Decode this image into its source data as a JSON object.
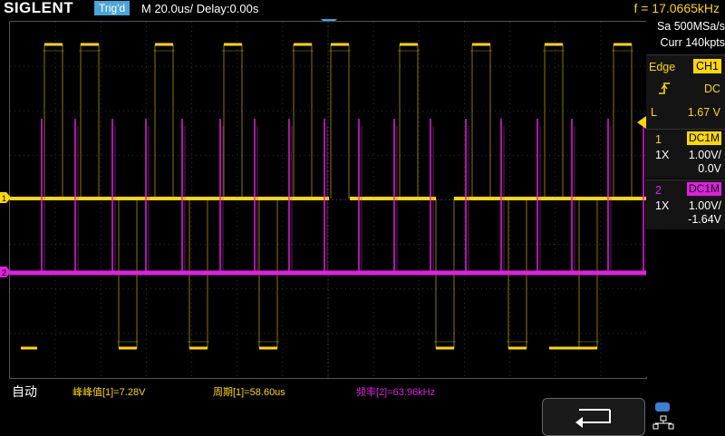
{
  "header": {
    "brand": "SIGLENT",
    "trig_status": "Trig'd",
    "timebase": "M 20.0us/  Delay:0.00s",
    "freq_readout": "f = 17.0665kHz"
  },
  "acquisition": {
    "sample_rate": "Sa 500MSa/s",
    "memory_depth": "Curr 140kpts"
  },
  "trigger": {
    "type": "Edge",
    "source": "CH1",
    "slope_icon": "rising-edge-icon",
    "coupling": "DC",
    "level_label": "L",
    "level_value": "1.67 V"
  },
  "channels": [
    {
      "number": "1",
      "coupling": "DC1M",
      "probe": "1X",
      "scale": "1.00V/",
      "offset": "0.0V",
      "color": "#ffd700"
    },
    {
      "number": "2",
      "coupling": "DC1M",
      "probe": "1X",
      "scale": "1.00V/",
      "offset": "-1.64V",
      "color": "#e020e0"
    }
  ],
  "footer": {
    "mode": "自动",
    "meas_vpp": "峰峰值[1]=7.28V",
    "meas_period": "周期[1]=58.60us",
    "meas_freq": "频率[2]=63.96kHz",
    "back_icon": "back-arrow-icon",
    "network_icon": "network-icon"
  },
  "colors": {
    "ch1": "#ffd700",
    "ch2": "#e020e0",
    "trig_status_bg": "#4aa6d8",
    "trigger_pointer": "#39a8e0"
  }
}
